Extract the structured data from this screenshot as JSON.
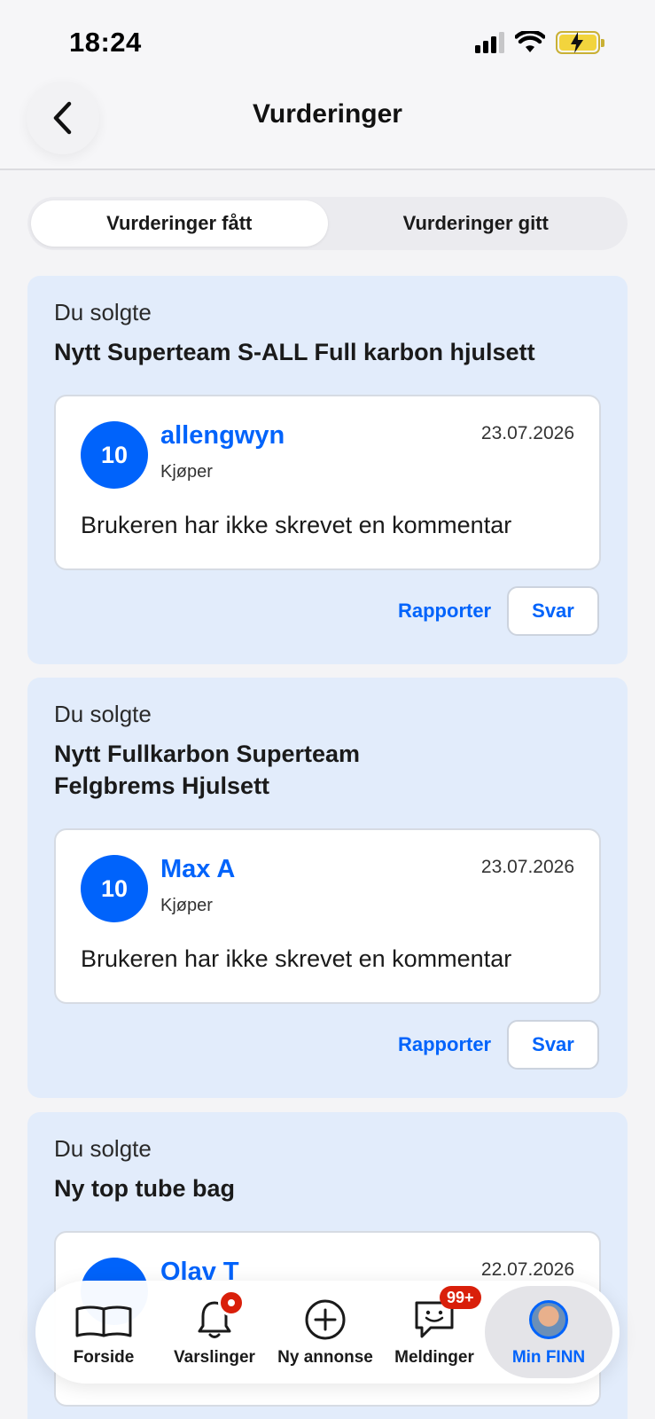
{
  "status_bar": {
    "time": "18:24"
  },
  "header": {
    "title": "Vurderinger"
  },
  "tabs": [
    {
      "label": "Vurderinger fått",
      "active": true
    },
    {
      "label": "Vurderinger gitt",
      "active": false
    }
  ],
  "ratings": [
    {
      "sold_label": "Du solgte",
      "item_title": "Nytt Superteam S-ALL Full karbon hjulsett",
      "score": "10",
      "reviewer": "allengwyn",
      "role": "Kjøper",
      "date": "23.07.2026",
      "comment": "Brukeren har ikke skrevet en kommentar",
      "report_label": "Rapporter",
      "reply_label": "Svar"
    },
    {
      "sold_label": "Du solgte",
      "item_title": "Nytt Fullkarbon Superteam Felgbrems Hjulsett",
      "score": "10",
      "reviewer": "Max A",
      "role": "Kjøper",
      "date": "23.07.2026",
      "comment": "Brukeren har ikke skrevet en kommentar",
      "report_label": "Rapporter",
      "reply_label": "Svar"
    },
    {
      "sold_label": "Du solgte",
      "item_title": "Ny top tube bag",
      "reviewer": "Olav T",
      "date": "22.07.2026"
    }
  ],
  "bottom_nav": [
    {
      "label": "Forside",
      "icon": "book-icon"
    },
    {
      "label": "Varslinger",
      "icon": "bell-icon",
      "badge": "dot"
    },
    {
      "label": "Ny annonse",
      "icon": "plus-circle-icon"
    },
    {
      "label": "Meldinger",
      "icon": "chat-icon",
      "badge": "99+"
    },
    {
      "label": "Min FINN",
      "icon": "avatar",
      "active": true
    }
  ],
  "colors": {
    "accent": "#0063fb",
    "card_bg": "#e2ecfb",
    "badge": "#d91f0a"
  }
}
